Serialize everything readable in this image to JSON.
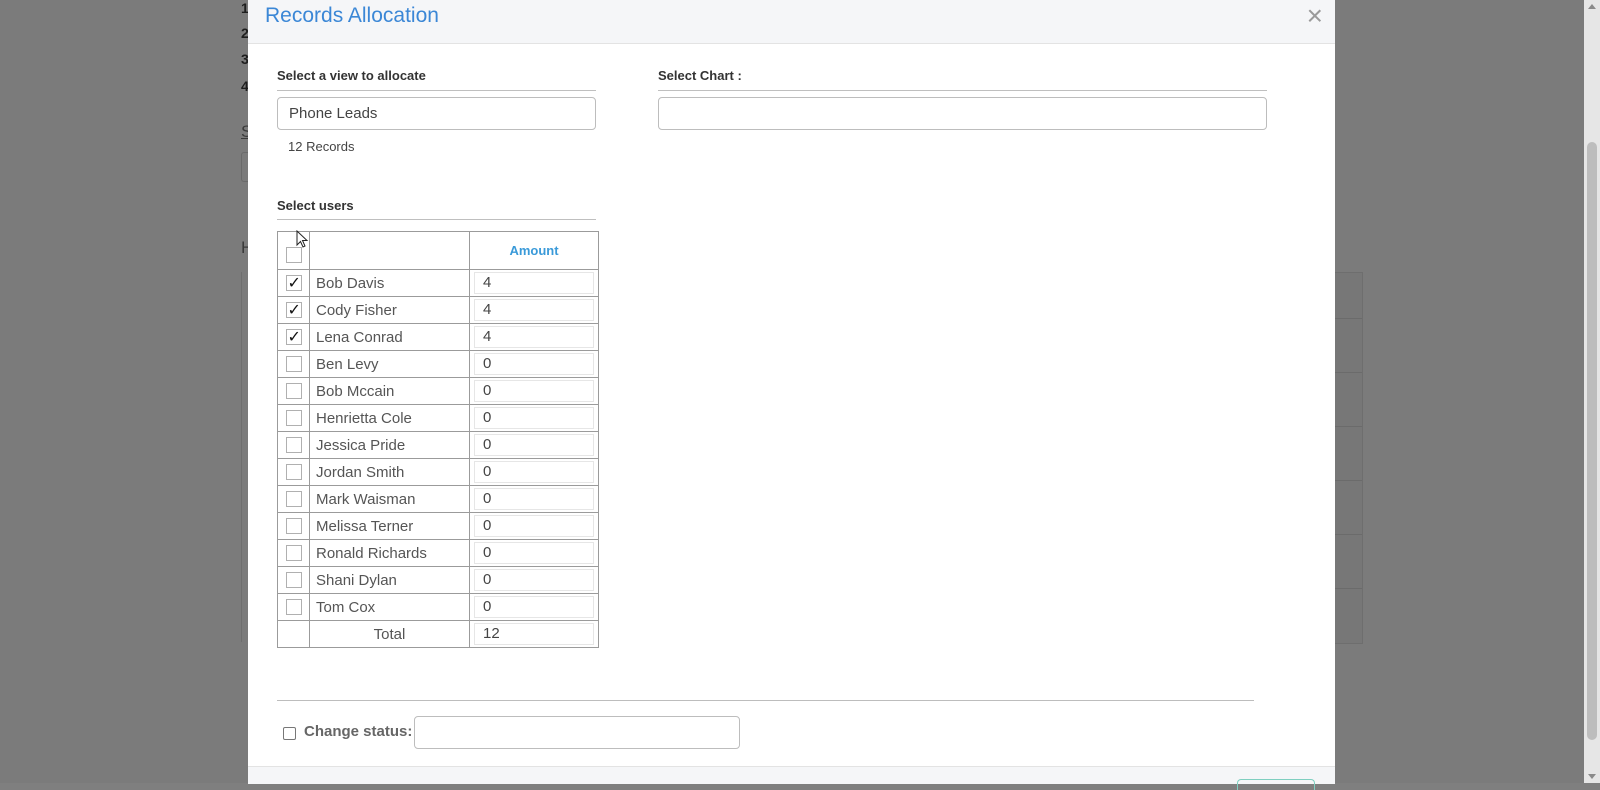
{
  "modal": {
    "title": "Records Allocation",
    "close_glyph": "×"
  },
  "view_section": {
    "label": "Select a view to allocate",
    "selected_view": "Phone Leads",
    "records_count": "12 Records"
  },
  "chart_section": {
    "label": "Select Chart :",
    "selected_chart": ""
  },
  "users_section": {
    "label": "Select users",
    "amount_header": "Amount",
    "users": [
      {
        "name": "Bob Davis",
        "amount": "4",
        "checked": true
      },
      {
        "name": "Cody Fisher",
        "amount": "4",
        "checked": true
      },
      {
        "name": "Lena Conrad",
        "amount": "4",
        "checked": true
      },
      {
        "name": "Ben Levy",
        "amount": "0",
        "checked": false
      },
      {
        "name": "Bob Mccain",
        "amount": "0",
        "checked": false
      },
      {
        "name": "Henrietta Cole",
        "amount": "0",
        "checked": false
      },
      {
        "name": "Jessica Pride",
        "amount": "0",
        "checked": false
      },
      {
        "name": "Jordan Smith",
        "amount": "0",
        "checked": false
      },
      {
        "name": "Mark Waisman",
        "amount": "0",
        "checked": false
      },
      {
        "name": "Melissa Terner",
        "amount": "0",
        "checked": false
      },
      {
        "name": "Ronald Richards",
        "amount": "0",
        "checked": false
      },
      {
        "name": "Shani Dylan",
        "amount": "0",
        "checked": false
      },
      {
        "name": "Tom Cox",
        "amount": "0",
        "checked": false
      }
    ],
    "total_label": "Total",
    "total_value": "12"
  },
  "change_status": {
    "label": "Change status:",
    "value": "",
    "checked": false
  },
  "background": {
    "list_numbers": [
      "1",
      "2",
      "3",
      "4"
    ],
    "link_initial": "S",
    "heading_initial": "H"
  },
  "colors": {
    "accent": "#3b87d6",
    "amount_header": "#3a9ad9",
    "overlay": "#7b7b7b"
  }
}
